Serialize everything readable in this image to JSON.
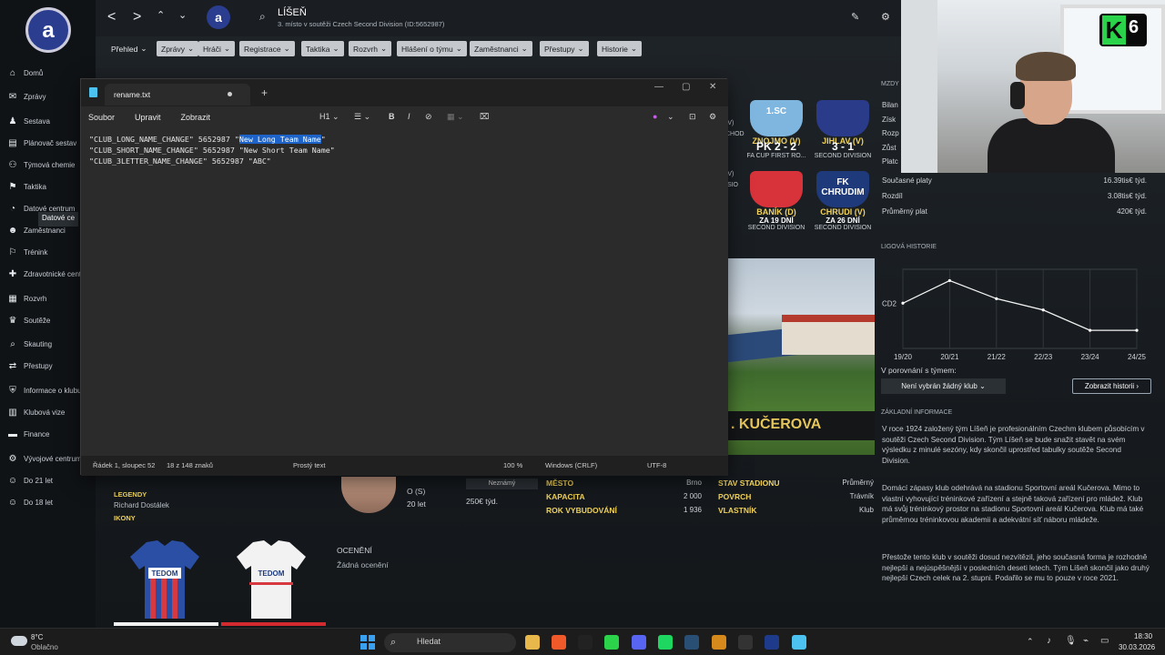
{
  "fm": {
    "nav_icons": {
      "back": "<",
      "forward": ">",
      "updown": "⌃",
      "dropdown": "⌄"
    },
    "club_title": "LÍŠEŇ",
    "club_subtitle": "3. místo v soutěži Czech Second Division (ID:5652987)",
    "logo_text": "a",
    "tabs": [
      "Přehled",
      "Zprávy",
      "Hráči",
      "Registrace",
      "Taktika",
      "Rozvrh",
      "Hlášení o týmu",
      "Zaměstnanci",
      "Přestupy",
      "Historie"
    ],
    "sidebar": [
      {
        "icon": "home-icon",
        "glyph": "⌂",
        "label": "Domů"
      },
      {
        "icon": "inbox-icon",
        "glyph": "✉",
        "label": "Zprávy"
      },
      {
        "icon": "squad-icon",
        "glyph": "♟",
        "label": "Sestava"
      },
      {
        "icon": "schedule-icon",
        "glyph": "▤",
        "label": "Plánovač sestav"
      },
      {
        "icon": "chemistry-icon",
        "glyph": "⚇",
        "label": "Týmová chemie"
      },
      {
        "icon": "tactics-icon",
        "glyph": "⚑",
        "label": "Taktika"
      },
      {
        "icon": "data-icon",
        "glyph": "◔",
        "label": "Datové centrum"
      },
      {
        "icon": "staff-icon",
        "glyph": "☻",
        "label": "Zaměstnanci"
      },
      {
        "icon": "training-icon",
        "glyph": "⚐",
        "label": "Trénink"
      },
      {
        "icon": "medical-icon",
        "glyph": "✚",
        "label": "Zdravotnické centrum"
      },
      {
        "icon": "schedule-grid-icon",
        "glyph": "▦",
        "label": "Rozvrh"
      },
      {
        "icon": "trophy-icon",
        "glyph": "♛",
        "label": "Soutěže"
      },
      {
        "icon": "scouting-icon",
        "glyph": "⌕",
        "label": "Skauting"
      },
      {
        "icon": "transfers-icon",
        "glyph": "⇄",
        "label": "Přestupy"
      },
      {
        "icon": "club-info-icon",
        "glyph": "⛨",
        "label": "Informace o klubu"
      },
      {
        "icon": "vision-icon",
        "glyph": "▥",
        "label": "Klubová vize"
      },
      {
        "icon": "finance-icon",
        "glyph": "▬",
        "label": "Finance"
      },
      {
        "icon": "development-icon",
        "glyph": "⚙",
        "label": "Vývojové centrum"
      },
      {
        "icon": "u21-icon",
        "glyph": "☺",
        "label": "Do 21 let"
      },
      {
        "icon": "u18-icon",
        "glyph": "☺",
        "label": "Do 18 let"
      }
    ],
    "sidebar_tooltip": "Datové ce",
    "matches": [
      {
        "badge": "1.SC",
        "team": "ZNOJMO (V)",
        "score": "PK 2 - 2",
        "comp": "FA CUP FIRST RO...",
        "color": "#7fb6e0"
      },
      {
        "badge": "",
        "team": "JIHLAV (V)",
        "score": "3 - 1",
        "comp": "SECOND DIVISION",
        "color": "#2a3b8a"
      },
      {
        "badge": "",
        "team": "BANÍK (D)",
        "score": "ZA 19 DNÍ",
        "comp": "SECOND DIVISION",
        "color": "#d8333a"
      },
      {
        "badge": "FK CHRUDIM",
        "team": "CHRUDI (V)",
        "score": "ZA 26 DNÍ",
        "comp": "SECOND DIVISION",
        "color": "#1f3a7a"
      }
    ],
    "left_match_bits": [
      "(V)",
      "CHOD",
      "(V)",
      "ISIO"
    ],
    "finance_heading": "MZDY",
    "finance_partial": [
      "Bilan",
      "Získ",
      "Rozp",
      "Zůst",
      "Platc"
    ],
    "finance": [
      {
        "label": "Současné platy",
        "value": "16.39tis€ týd."
      },
      {
        "label": "Rozdíl",
        "value": "3.08tis€ týd."
      },
      {
        "label": "Průměrný plat",
        "value": "420€ týd."
      }
    ],
    "history_heading": "LIGOVÁ HISTORIE",
    "history_chart": {
      "type": "line",
      "categories": [
        "19/20",
        "20/21",
        "21/22",
        "22/23",
        "23/24",
        "24/25"
      ],
      "y_label": "CD2",
      "values": [
        2,
        1,
        1.8,
        2.3,
        3.2,
        3.2
      ]
    },
    "compare_label": "V porovnání s týmem:",
    "compare_select": "Není vybrán žádný klub",
    "history_button": "Zobrazit historii",
    "info_heading": "ZÁKLADNÍ INFORMACE",
    "info_paragraphs": [
      "V roce 1924 založený tým Líšeň je profesionálním Czechm klubem působícím v soutěži Czech Second Division. Tým Líšeň se bude snažit stavět na svém výsledku z minulé sezóny, kdy skončil uprostřed tabulky soutěže Second Division.",
      "Domácí zápasy klub odehrává na stadionu Sportovní areál Kučerova. Mimo to vlastní vyhovující tréninkové zařízení a stejně taková zařízení pro mládež. Klub má svůj tréninkový prostor na stadionu Sportovní areál Kučerova. Klub má také průměrnou tréninkovou akademii a adekvátní síť náboru mládeže.",
      "Přestože tento klub v soutěži dosud nezvítězil, jeho současná forma je rozhodně nejlepší a nejúspěšnější v posledních deseti letech. Tým Líšeň skončil jako druhý nejlepší Czech celek na 2. stupni. Podařilo se mu to pouze v roce 2021."
    ],
    "stadium_name": "KUČEROVA",
    "legends_label": "LEGENDY",
    "legend_name": "Richard Dostálek",
    "icons_label": "IKONY",
    "player_pos": "O (S)",
    "player_age": "20 let",
    "player_wage": "250€ týd.",
    "player_status": "Neznámý",
    "awards_label": "OCENĚNÍ",
    "awards_value": "Žádná ocenění",
    "kit_sponsor": "TEDOM",
    "stadium_stats_left": [
      {
        "label": "MĚSTO",
        "value": "Brno"
      },
      {
        "label": "KAPACITA",
        "value": "2 000"
      },
      {
        "label": "ROK VYBUDOVÁNÍ",
        "value": "1 936"
      }
    ],
    "stadium_stats_right": [
      {
        "label": "STAV STADIONU",
        "value": "Průměrný"
      },
      {
        "label": "POVRCH",
        "value": "Trávník"
      },
      {
        "label": "VLASTNÍK",
        "value": "Klub"
      }
    ]
  },
  "notepad": {
    "tab_title": "rename.txt",
    "new_tab": "+",
    "menu": [
      "Soubor",
      "Upravit",
      "Zobrazit"
    ],
    "heading_select": "H1",
    "lines": {
      "l1_prefix": "\"CLUB_LONG_NAME_CHANGE\" 5652987 \"",
      "l1_selected": "New Long Team Name",
      "l1_suffix": "\"",
      "l2": "\"CLUB_SHORT_NAME_CHANGE\" 5652987 \"New Short Team Name\"",
      "l3": "\"CLUB_3LETTER_NAME_CHANGE\" 5652987 \"ABC\""
    },
    "status": {
      "position": "Řádek 1, sloupec 52",
      "chars": "18 z 148 znaků",
      "format": "Prostý text",
      "zoom": "100 %",
      "line_ending": "Windows (CRLF)",
      "encoding": "UTF-8"
    }
  },
  "taskbar": {
    "weather_temp": "8°C",
    "weather_desc": "Oblačno",
    "search_placeholder": "Hledat",
    "time": "18:30",
    "date": "30.03.2026"
  },
  "overlay": {
    "k6_letter": "K",
    "k6_number": "6"
  },
  "colors": {
    "accent_yellow": "#f0d25a",
    "selection": "#1d63c8",
    "club_blue": "#2a3d8f"
  }
}
